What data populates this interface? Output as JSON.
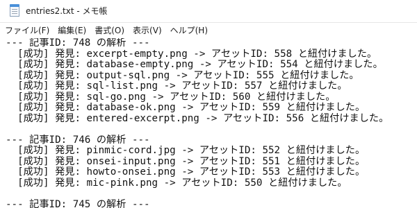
{
  "window": {
    "title": "entries2.txt - メモ帳",
    "icon": "notepad-icon"
  },
  "menu": [
    {
      "label": "ファイル(F)"
    },
    {
      "label": "編集(E)"
    },
    {
      "label": "書式(O)"
    },
    {
      "label": "表示(V)"
    },
    {
      "label": "ヘルプ(H)"
    }
  ],
  "editor": {
    "lines": [
      "--- 記事ID: 748 の解析 ---",
      "  [成功] 発見: excerpt-empty.png -> アセットID: 558 と紐付けました。",
      "  [成功] 発見: database-empty.png -> アセットID: 554 と紐付けました。",
      "  [成功] 発見: output-sql.png -> アセットID: 555 と紐付けました。",
      "  [成功] 発見: sql-list.png -> アセットID: 557 と紐付けました。",
      "  [成功] 発見: sql-go.png -> アセットID: 560 と紐付けました。",
      "  [成功] 発見: database-ok.png -> アセットID: 559 と紐付けました。",
      "  [成功] 発見: entered-excerpt.png -> アセットID: 556 と紐付けました。",
      "",
      "--- 記事ID: 746 の解析 ---",
      "  [成功] 発見: pinmic-cord.jpg -> アセットID: 552 と紐付けました。",
      "  [成功] 発見: onsei-input.png -> アセットID: 551 と紐付けました。",
      "  [成功] 発見: howto-onsei.png -> アセットID: 553 と紐付けました。",
      "  [成功] 発見: mic-pink.png -> アセットID: 550 と紐付けました。",
      "",
      "--- 記事ID: 745 の解析 ---"
    ]
  }
}
